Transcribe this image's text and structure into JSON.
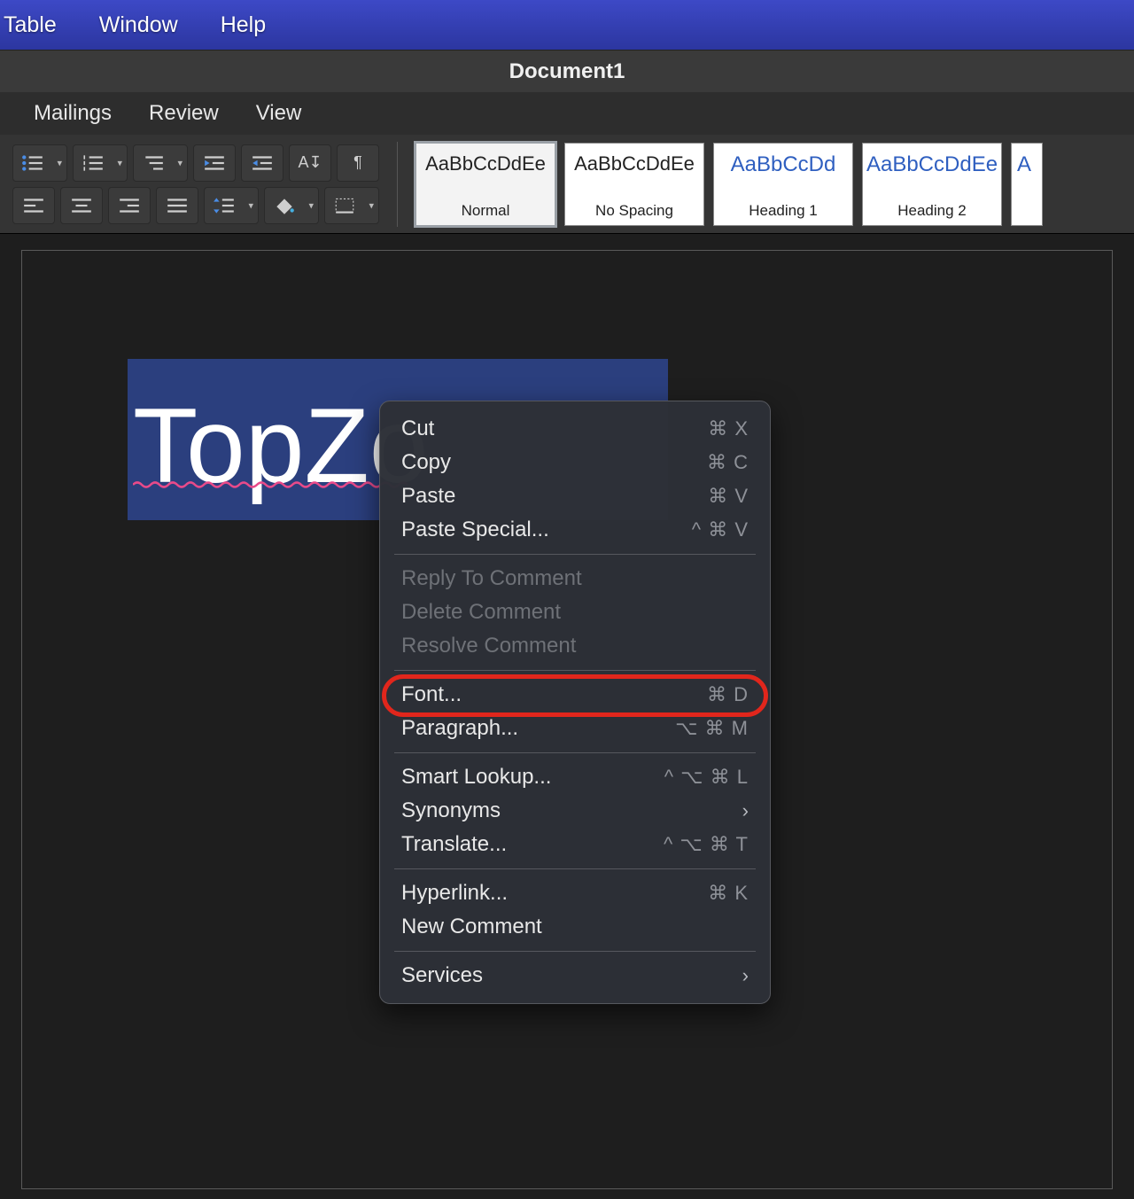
{
  "menubar": {
    "table": "Table",
    "window": "Window",
    "help": "Help"
  },
  "title": "Document1",
  "ribbon_tabs": {
    "mailings": "Mailings",
    "review": "Review",
    "view": "View"
  },
  "styles": [
    {
      "sample": "AaBbCcDdEe",
      "label": "Normal"
    },
    {
      "sample": "AaBbCcDdEe",
      "label": "No Spacing"
    },
    {
      "sample": "AaBbCcDd",
      "label": "Heading 1"
    },
    {
      "sample": "AaBbCcDdEe",
      "label": "Heading 2"
    },
    {
      "sample": "A",
      "label": ""
    }
  ],
  "document": {
    "selected_text": "TopZo"
  },
  "context_menu": {
    "cut": {
      "label": "Cut",
      "shortcut": "⌘ X"
    },
    "copy": {
      "label": "Copy",
      "shortcut": "⌘ C"
    },
    "paste": {
      "label": "Paste",
      "shortcut": "⌘ V"
    },
    "paste_special": {
      "label": "Paste Special...",
      "shortcut": "^ ⌘ V"
    },
    "reply_comment": {
      "label": "Reply To Comment"
    },
    "delete_comment": {
      "label": "Delete Comment"
    },
    "resolve_comment": {
      "label": "Resolve Comment"
    },
    "font": {
      "label": "Font...",
      "shortcut": "⌘ D"
    },
    "paragraph": {
      "label": "Paragraph...",
      "shortcut": "⌥ ⌘ M"
    },
    "smart_lookup": {
      "label": "Smart Lookup...",
      "shortcut": "^ ⌥ ⌘ L"
    },
    "synonyms": {
      "label": "Synonyms"
    },
    "translate": {
      "label": "Translate...",
      "shortcut": "^ ⌥ ⌘ T"
    },
    "hyperlink": {
      "label": "Hyperlink...",
      "shortcut": "⌘ K"
    },
    "new_comment": {
      "label": "New Comment"
    },
    "services": {
      "label": "Services"
    }
  }
}
